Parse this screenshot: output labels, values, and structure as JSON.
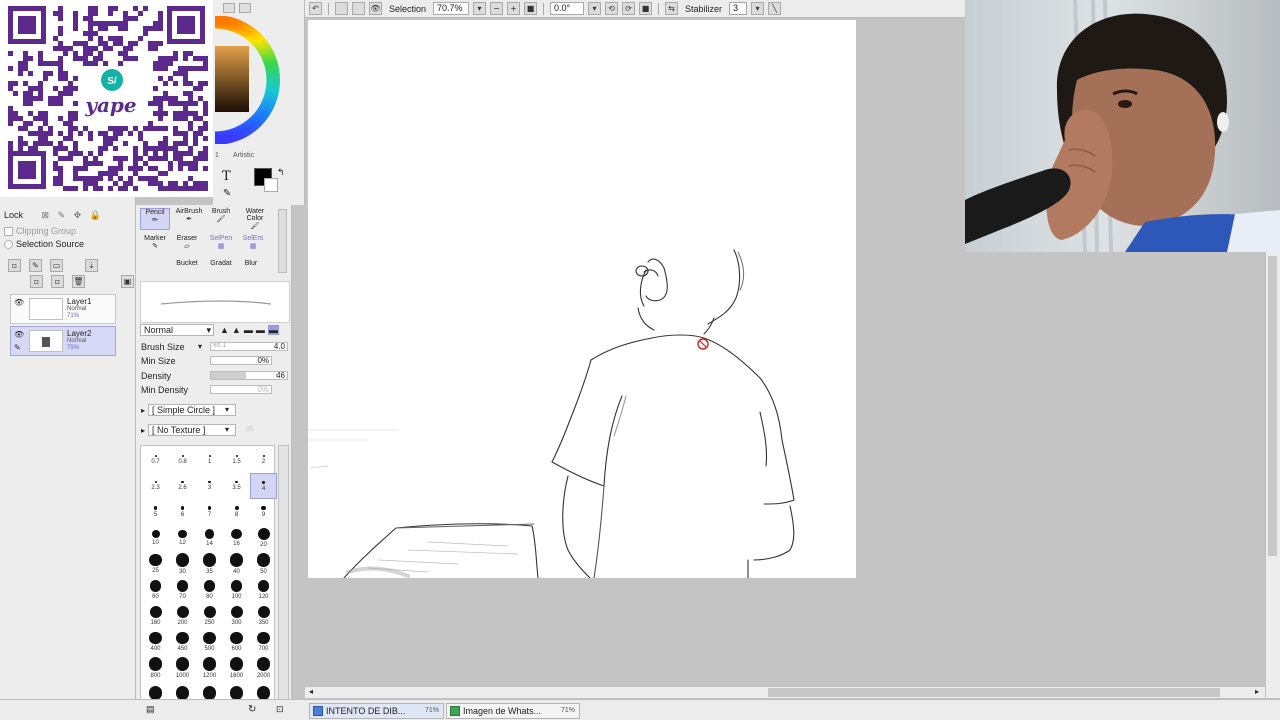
{
  "toolbar": {
    "selection_label": "Selection",
    "zoom_value": "70.7%",
    "rotation_value": "0.0°",
    "stabilizer_label": "Stabilizer",
    "stabilizer_value": "3"
  },
  "color_panel": {
    "tab1": "1",
    "tab2": "Artistic"
  },
  "layer_panel": {
    "lock_label": "Lock",
    "clipping_group_label": "Clipping Group",
    "selection_source_label": "Selection Source",
    "layers": [
      {
        "name": "Layer1",
        "mode": "Normal",
        "opacity": "71%"
      },
      {
        "name": "Layer2",
        "mode": "Normal",
        "opacity": "75%"
      }
    ]
  },
  "tool_panel": {
    "tools_row1": [
      "Pencil",
      "AirBrush",
      "Brush",
      "Water Color"
    ],
    "tools_row2": [
      "Marker",
      "Eraser",
      "SelPen",
      "SelErs"
    ],
    "tools_row3": [
      "Bucket",
      "Gradat",
      "Blur"
    ],
    "blend_mode": "Normal",
    "brush_size_label": "Brush Size",
    "brush_size_multiplier": "x0.1",
    "brush_size_value": "4.0",
    "min_size_label": "Min Size",
    "min_size_value": "0%",
    "density_label": "Density",
    "density_value": "46",
    "min_density_label": "Min Density",
    "min_density_value": "0%",
    "shape_label": "[ Simple Circle ]",
    "texture_label": "[ No Texture ]",
    "texture_strength": "95"
  },
  "brush_sizes": [
    [
      "0.7",
      "0.8",
      "1",
      "1.5",
      "2"
    ],
    [
      "2.3",
      "2.6",
      "3",
      "3.5",
      "4"
    ],
    [
      "5",
      "6",
      "7",
      "8",
      "9"
    ],
    [
      "10",
      "12",
      "14",
      "16",
      "20"
    ],
    [
      "25",
      "30",
      "35",
      "40",
      "50"
    ],
    [
      "60",
      "70",
      "80",
      "100",
      "120"
    ],
    [
      "160",
      "200",
      "250",
      "300",
      "350"
    ],
    [
      "400",
      "450",
      "500",
      "600",
      "700"
    ],
    [
      "800",
      "1000",
      "1200",
      "1600",
      "2000"
    ],
    [
      "",
      "",
      "",
      "",
      ""
    ]
  ],
  "selected_brush_size": "4",
  "taskbar": {
    "tasks": [
      {
        "title": "INTENTO DE DIB...",
        "zoom": "71%"
      },
      {
        "title": "Imagen de Whats...",
        "zoom": "71%"
      }
    ]
  },
  "colors": {
    "panel_bg": "#ededed",
    "workspace_bg": "#c4c4c4",
    "selection_highlight": "#d4d4f4",
    "qr_purple": "#5b2a8c",
    "qr_badge_teal": "#12b3a6",
    "primary_color": "#000000"
  },
  "overlay": {
    "qr_brand": "yape",
    "qr_badge": "S/"
  }
}
